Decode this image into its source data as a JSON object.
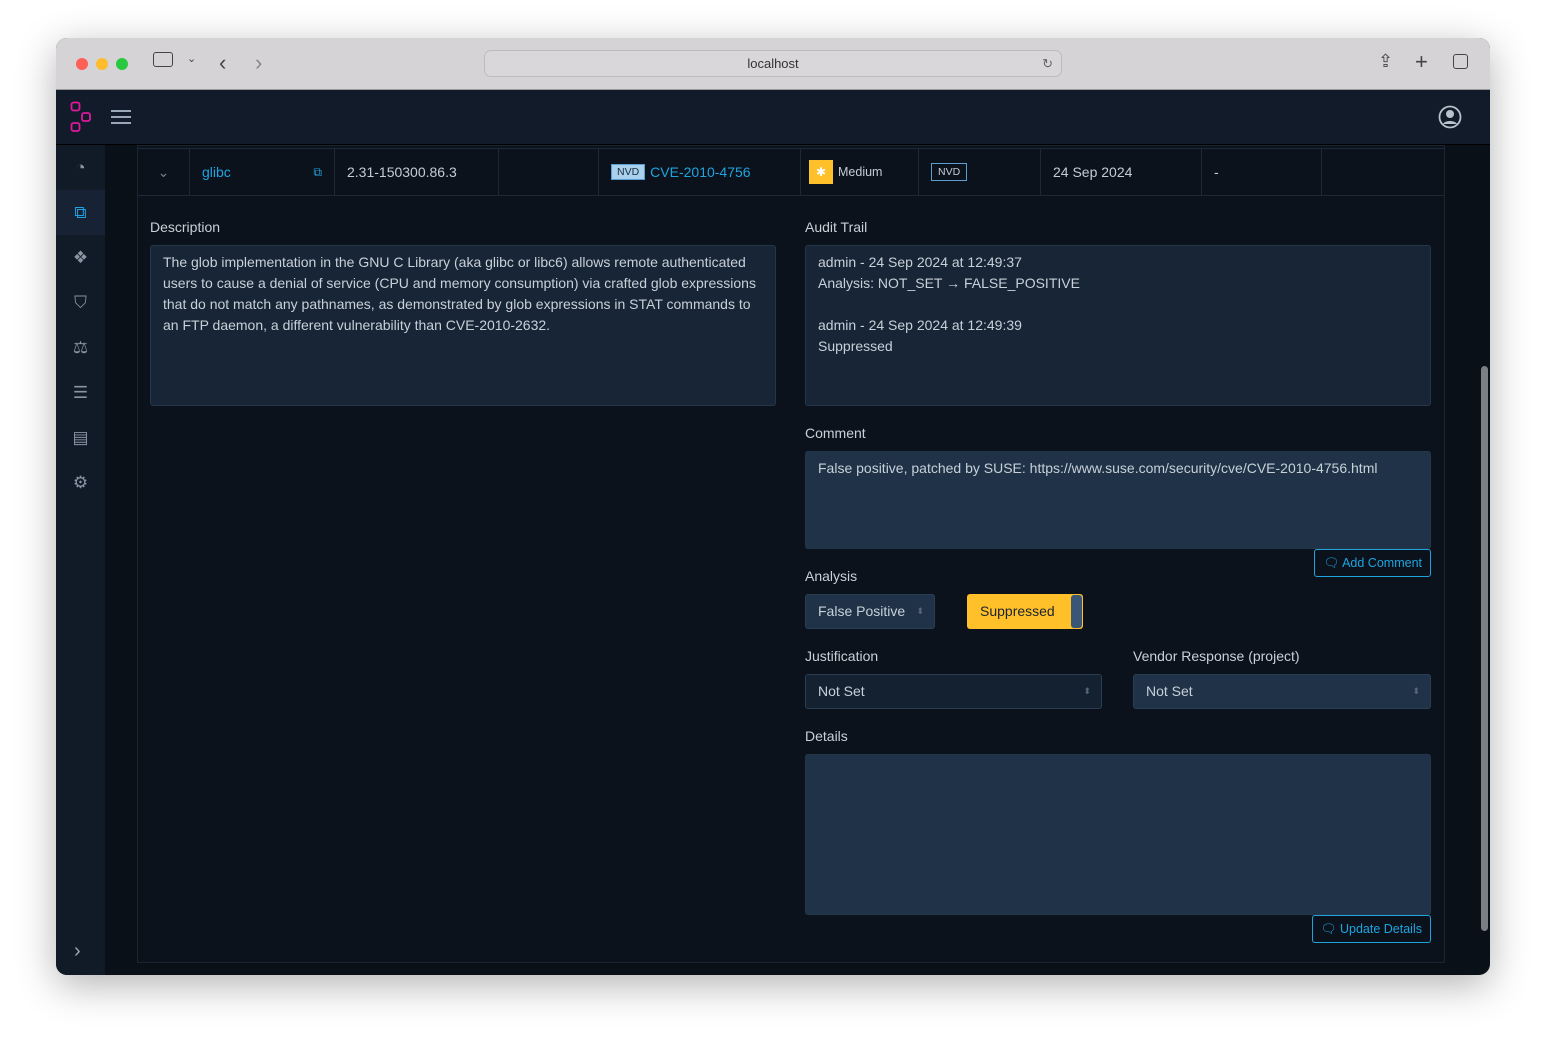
{
  "browser": {
    "url": "localhost"
  },
  "sidebar": {
    "items": [
      {
        "icon": "dashboard-icon"
      },
      {
        "icon": "sitemap-icon",
        "active": true
      },
      {
        "icon": "cubes-icon"
      },
      {
        "icon": "shield-icon"
      },
      {
        "icon": "balance-scale-icon"
      },
      {
        "icon": "server-icon"
      },
      {
        "icon": "list-icon"
      },
      {
        "icon": "cogs-icon"
      }
    ]
  },
  "row": {
    "component": "glibc",
    "version": "2.31-150300.86.3",
    "source": "NVD",
    "vuln_id": "CVE-2010-4756",
    "severity": "Medium",
    "analyzer": "NVD",
    "attributed_on": "24 Sep 2024",
    "analysis": "-"
  },
  "details": {
    "description_label": "Description",
    "description": "The glob implementation in the GNU C Library (aka glibc or libc6) allows remote authenticated users to cause a denial of service (CPU and memory consumption) via crafted glob expressions that do not match any pathnames, as demonstrated by glob expressions in STAT commands to an FTP daemon, a different vulnerability than CVE-2010-2632.",
    "audit_label": "Audit Trail",
    "audit": [
      "admin - 24 Sep 2024 at 12:49:37",
      "Analysis: NOT_SET → FALSE_POSITIVE",
      "",
      "admin - 24 Sep 2024 at 12:49:39",
      "Suppressed"
    ],
    "comment_label": "Comment",
    "comment": "False positive, patched by SUSE: https://www.suse.com/security/cve/CVE-2010-4756.html",
    "add_comment": "Add Comment",
    "analysis_label": "Analysis",
    "analysis_value": "False Positive",
    "suppressed_label": "Suppressed",
    "suppressed": true,
    "justification_label": "Justification",
    "justification_value": "Not Set",
    "vendor_label": "Vendor Response (project)",
    "vendor_value": "Not Set",
    "details_label": "Details",
    "update_details": "Update Details"
  },
  "colors": {
    "accent": "#1fa4e0",
    "warning": "#ffc029",
    "logo": "#e0189c"
  }
}
